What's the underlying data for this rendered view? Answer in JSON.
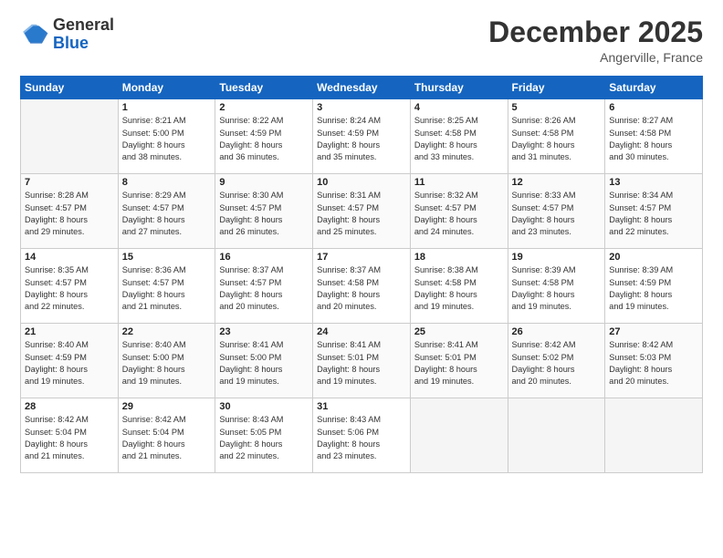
{
  "logo": {
    "line1": "General",
    "line2": "Blue"
  },
  "title": "December 2025",
  "location": "Angerville, France",
  "days_header": [
    "Sunday",
    "Monday",
    "Tuesday",
    "Wednesday",
    "Thursday",
    "Friday",
    "Saturday"
  ],
  "weeks": [
    [
      {
        "num": "",
        "info": ""
      },
      {
        "num": "1",
        "info": "Sunrise: 8:21 AM\nSunset: 5:00 PM\nDaylight: 8 hours\nand 38 minutes."
      },
      {
        "num": "2",
        "info": "Sunrise: 8:22 AM\nSunset: 4:59 PM\nDaylight: 8 hours\nand 36 minutes."
      },
      {
        "num": "3",
        "info": "Sunrise: 8:24 AM\nSunset: 4:59 PM\nDaylight: 8 hours\nand 35 minutes."
      },
      {
        "num": "4",
        "info": "Sunrise: 8:25 AM\nSunset: 4:58 PM\nDaylight: 8 hours\nand 33 minutes."
      },
      {
        "num": "5",
        "info": "Sunrise: 8:26 AM\nSunset: 4:58 PM\nDaylight: 8 hours\nand 31 minutes."
      },
      {
        "num": "6",
        "info": "Sunrise: 8:27 AM\nSunset: 4:58 PM\nDaylight: 8 hours\nand 30 minutes."
      }
    ],
    [
      {
        "num": "7",
        "info": "Sunrise: 8:28 AM\nSunset: 4:57 PM\nDaylight: 8 hours\nand 29 minutes."
      },
      {
        "num": "8",
        "info": "Sunrise: 8:29 AM\nSunset: 4:57 PM\nDaylight: 8 hours\nand 27 minutes."
      },
      {
        "num": "9",
        "info": "Sunrise: 8:30 AM\nSunset: 4:57 PM\nDaylight: 8 hours\nand 26 minutes."
      },
      {
        "num": "10",
        "info": "Sunrise: 8:31 AM\nSunset: 4:57 PM\nDaylight: 8 hours\nand 25 minutes."
      },
      {
        "num": "11",
        "info": "Sunrise: 8:32 AM\nSunset: 4:57 PM\nDaylight: 8 hours\nand 24 minutes."
      },
      {
        "num": "12",
        "info": "Sunrise: 8:33 AM\nSunset: 4:57 PM\nDaylight: 8 hours\nand 23 minutes."
      },
      {
        "num": "13",
        "info": "Sunrise: 8:34 AM\nSunset: 4:57 PM\nDaylight: 8 hours\nand 22 minutes."
      }
    ],
    [
      {
        "num": "14",
        "info": "Sunrise: 8:35 AM\nSunset: 4:57 PM\nDaylight: 8 hours\nand 22 minutes."
      },
      {
        "num": "15",
        "info": "Sunrise: 8:36 AM\nSunset: 4:57 PM\nDaylight: 8 hours\nand 21 minutes."
      },
      {
        "num": "16",
        "info": "Sunrise: 8:37 AM\nSunset: 4:57 PM\nDaylight: 8 hours\nand 20 minutes."
      },
      {
        "num": "17",
        "info": "Sunrise: 8:37 AM\nSunset: 4:58 PM\nDaylight: 8 hours\nand 20 minutes."
      },
      {
        "num": "18",
        "info": "Sunrise: 8:38 AM\nSunset: 4:58 PM\nDaylight: 8 hours\nand 19 minutes."
      },
      {
        "num": "19",
        "info": "Sunrise: 8:39 AM\nSunset: 4:58 PM\nDaylight: 8 hours\nand 19 minutes."
      },
      {
        "num": "20",
        "info": "Sunrise: 8:39 AM\nSunset: 4:59 PM\nDaylight: 8 hours\nand 19 minutes."
      }
    ],
    [
      {
        "num": "21",
        "info": "Sunrise: 8:40 AM\nSunset: 4:59 PM\nDaylight: 8 hours\nand 19 minutes."
      },
      {
        "num": "22",
        "info": "Sunrise: 8:40 AM\nSunset: 5:00 PM\nDaylight: 8 hours\nand 19 minutes."
      },
      {
        "num": "23",
        "info": "Sunrise: 8:41 AM\nSunset: 5:00 PM\nDaylight: 8 hours\nand 19 minutes."
      },
      {
        "num": "24",
        "info": "Sunrise: 8:41 AM\nSunset: 5:01 PM\nDaylight: 8 hours\nand 19 minutes."
      },
      {
        "num": "25",
        "info": "Sunrise: 8:41 AM\nSunset: 5:01 PM\nDaylight: 8 hours\nand 19 minutes."
      },
      {
        "num": "26",
        "info": "Sunrise: 8:42 AM\nSunset: 5:02 PM\nDaylight: 8 hours\nand 20 minutes."
      },
      {
        "num": "27",
        "info": "Sunrise: 8:42 AM\nSunset: 5:03 PM\nDaylight: 8 hours\nand 20 minutes."
      }
    ],
    [
      {
        "num": "28",
        "info": "Sunrise: 8:42 AM\nSunset: 5:04 PM\nDaylight: 8 hours\nand 21 minutes."
      },
      {
        "num": "29",
        "info": "Sunrise: 8:42 AM\nSunset: 5:04 PM\nDaylight: 8 hours\nand 21 minutes."
      },
      {
        "num": "30",
        "info": "Sunrise: 8:43 AM\nSunset: 5:05 PM\nDaylight: 8 hours\nand 22 minutes."
      },
      {
        "num": "31",
        "info": "Sunrise: 8:43 AM\nSunset: 5:06 PM\nDaylight: 8 hours\nand 23 minutes."
      },
      {
        "num": "",
        "info": ""
      },
      {
        "num": "",
        "info": ""
      },
      {
        "num": "",
        "info": ""
      }
    ]
  ]
}
